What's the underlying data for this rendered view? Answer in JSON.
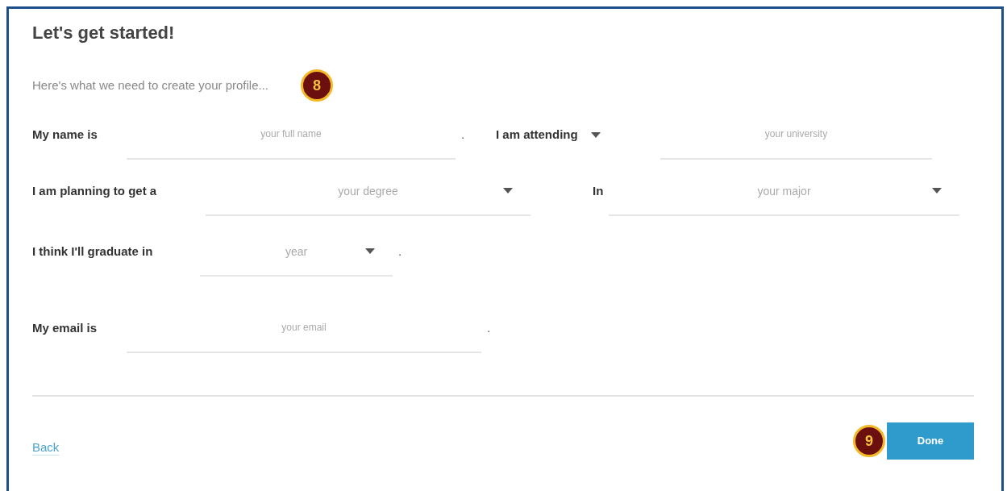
{
  "title": "Let's get started!",
  "subtitle": "Here's what we need to create your profile...",
  "step_badges": [
    {
      "label": "8"
    },
    {
      "label": "9"
    }
  ],
  "rows": [
    {
      "items": [
        {
          "kind": "label",
          "text": "My name is"
        },
        {
          "kind": "field",
          "placeholder": "your full name"
        },
        {
          "kind": "period",
          "text": "."
        },
        {
          "kind": "dropdown_label",
          "text": "I am attending"
        },
        {
          "kind": "field",
          "placeholder": "your university"
        }
      ]
    },
    {
      "items": [
        {
          "kind": "label",
          "text": "I am planning to get a"
        },
        {
          "kind": "select",
          "placeholder": "your degree"
        },
        {
          "kind": "label",
          "text": "In"
        },
        {
          "kind": "select",
          "placeholder": "your major"
        }
      ]
    },
    {
      "items": [
        {
          "kind": "label",
          "text": "I think I'll graduate in"
        },
        {
          "kind": "select",
          "placeholder": "year"
        },
        {
          "kind": "period",
          "text": "."
        }
      ]
    },
    {
      "items": [
        {
          "kind": "label",
          "text": "My email is"
        },
        {
          "kind": "field",
          "placeholder": "your email"
        },
        {
          "kind": "period",
          "text": "."
        }
      ]
    }
  ],
  "back_link": "Back",
  "done_button": "Done"
}
